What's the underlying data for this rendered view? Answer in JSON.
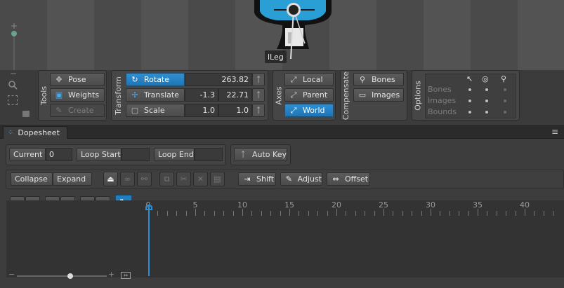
{
  "viewport": {
    "bone_label": "lLeg"
  },
  "tools": {
    "title": "Tools",
    "pose": "Pose",
    "weights": "Weights",
    "create": "Create"
  },
  "transform": {
    "title": "Transform",
    "rotate": {
      "label": "Rotate",
      "value": "263.82"
    },
    "translate": {
      "label": "Translate",
      "x": "-1.3",
      "y": "22.71"
    },
    "scale": {
      "label": "Scale",
      "x": "1.0",
      "y": "1.0"
    }
  },
  "axes": {
    "title": "Axes",
    "local": "Local",
    "parent": "Parent",
    "world": "World"
  },
  "compensate": {
    "title": "Compensate",
    "bones": "Bones",
    "images": "Images"
  },
  "options": {
    "title": "Options",
    "rows": [
      "Bones",
      "Images",
      "Bounds"
    ]
  },
  "dopesheet": {
    "tab_label": "Dopesheet",
    "current_label": "Current",
    "current_value": "0",
    "loop_start": "Loop Start",
    "loop_end": "Loop End",
    "auto_key": "Auto Key",
    "collapse": "Collapse",
    "expand": "Expand",
    "shift": "Shift",
    "adjust": "Adjust",
    "offset": "Offset",
    "ruler_labels": [
      "0",
      "5",
      "10",
      "15",
      "20",
      "25",
      "30",
      "35",
      "40"
    ],
    "current_frame": 0
  },
  "colors": {
    "accent": "#1f7fc2",
    "panel": "#464646",
    "background": "#3d3d3d"
  }
}
